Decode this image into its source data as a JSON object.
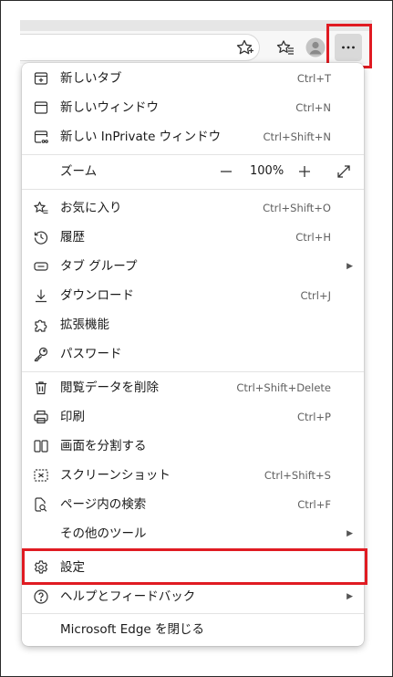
{
  "toolbar": {
    "favorite_icon": "star-add-icon",
    "favorites_icon": "favorites-icon",
    "profile_icon": "profile-avatar-icon",
    "more_icon": "more-horizontal-icon"
  },
  "highlight_color": "#e01b22",
  "menu": {
    "new_tab": {
      "label": "新しいタブ",
      "shortcut": "Ctrl+T"
    },
    "new_window": {
      "label": "新しいウィンドウ",
      "shortcut": "Ctrl+N"
    },
    "new_inprivate": {
      "label": "新しい InPrivate ウィンドウ",
      "shortcut": "Ctrl+Shift+N"
    },
    "zoom": {
      "label": "ズーム",
      "value": "100%",
      "minus": "—",
      "plus": "+"
    },
    "favorites": {
      "label": "お気に入り",
      "shortcut": "Ctrl+Shift+O"
    },
    "history": {
      "label": "履歴",
      "shortcut": "Ctrl+H"
    },
    "tab_groups": {
      "label": "タブ グループ"
    },
    "downloads": {
      "label": "ダウンロード",
      "shortcut": "Ctrl+J"
    },
    "extensions": {
      "label": "拡張機能"
    },
    "passwords": {
      "label": "パスワード"
    },
    "clear_data": {
      "label": "閲覧データを削除",
      "shortcut": "Ctrl+Shift+Delete"
    },
    "print": {
      "label": "印刷",
      "shortcut": "Ctrl+P"
    },
    "split_screen": {
      "label": "画面を分割する"
    },
    "screenshot": {
      "label": "スクリーンショット",
      "shortcut": "Ctrl+Shift+S"
    },
    "find": {
      "label": "ページ内の検索",
      "shortcut": "Ctrl+F"
    },
    "more_tools": {
      "label": "その他のツール"
    },
    "settings": {
      "label": "設定"
    },
    "help": {
      "label": "ヘルプとフィードバック"
    },
    "close_edge": {
      "label": "Microsoft Edge を閉じる"
    }
  }
}
